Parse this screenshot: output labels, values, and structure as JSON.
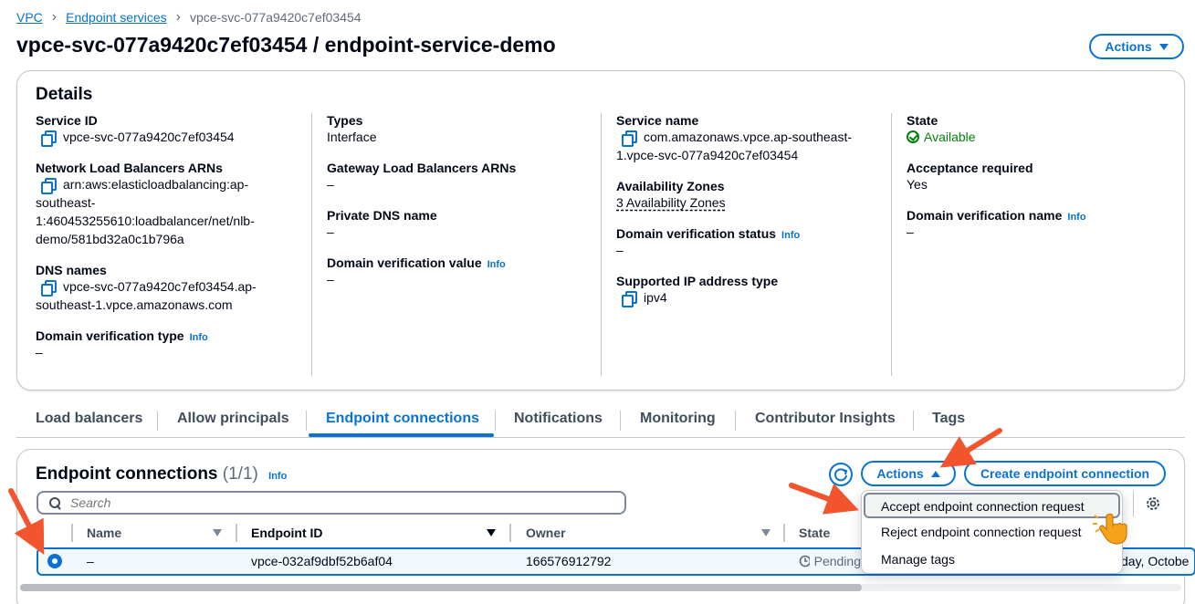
{
  "breadcrumb": {
    "items": [
      "VPC",
      "Endpoint services"
    ],
    "current": "vpce-svc-077a9420c7ef03454"
  },
  "page_title": "vpce-svc-077a9420c7ef03454 / endpoint-service-demo",
  "header_actions_label": "Actions",
  "details": {
    "heading": "Details",
    "info_label": "Info",
    "col1": {
      "service_id_label": "Service ID",
      "service_id": "vpce-svc-077a9420c7ef03454",
      "nlb_arns_label": "Network Load Balancers ARNs",
      "nlb_arn_line1": "arn:aws:elasticloadbalancing:ap-",
      "nlb_arn_line2": "southeast-",
      "nlb_arn_line3": "1:460453255610:loadbalancer/net/nlb-",
      "nlb_arn_line4": "demo/581bd32a0c1b796a",
      "dns_names_label": "DNS names",
      "dns_line1": "vpce-svc-077a9420c7ef03454.ap-",
      "dns_line2": "southeast-1.vpce.amazonaws.com",
      "domain_verification_type_label": "Domain verification type",
      "domain_verification_type": "–"
    },
    "col2": {
      "types_label": "Types",
      "types": "Interface",
      "gwlb_arns_label": "Gateway Load Balancers ARNs",
      "gwlb_arns": "–",
      "private_dns_label": "Private DNS name",
      "private_dns": "–",
      "domain_verification_value_label": "Domain verification value",
      "domain_verification_value": "–"
    },
    "col3": {
      "service_name_label": "Service name",
      "service_name_line1": "com.amazonaws.vpce.ap-southeast-",
      "service_name_line2": "1.vpce-svc-077a9420c7ef03454",
      "az_label": "Availability Zones",
      "az": "3 Availability Zones",
      "domain_verification_status_label": "Domain verification status",
      "domain_verification_status": "–",
      "supported_ip_label": "Supported IP address type",
      "supported_ip": "ipv4"
    },
    "col4": {
      "state_label": "State",
      "state": "Available",
      "acceptance_label": "Acceptance required",
      "acceptance": "Yes",
      "domain_verification_name_label": "Domain verification name",
      "domain_verification_name": "–"
    }
  },
  "tabs": [
    "Load balancers",
    "Allow principals",
    "Endpoint connections",
    "Notifications",
    "Monitoring",
    "Contributor Insights",
    "Tags"
  ],
  "connections": {
    "heading": "Endpoint connections",
    "count": "(1/1)",
    "info_label": "Info",
    "actions_label": "Actions",
    "create_label": "Create endpoint connection",
    "search_placeholder": "Search",
    "columns": [
      "Name",
      "Endpoint ID",
      "Owner",
      "State"
    ],
    "rows": [
      {
        "name": "–",
        "endpoint_id": "vpce-032af9dbf52b6af04",
        "owner": "166576912792",
        "state": "Pending",
        "date_fragment": "day, Octobe"
      }
    ],
    "menu_items": [
      "Accept endpoint connection request",
      "Reject endpoint connection request",
      "Manage tags"
    ]
  },
  "colors": {
    "accent": "#0972d3",
    "success": "#037f0c",
    "annotation_arrow": "#f2542d",
    "pointer": "#f7a21b"
  }
}
